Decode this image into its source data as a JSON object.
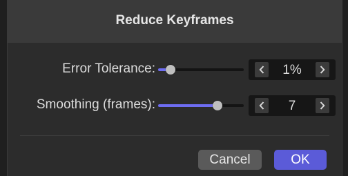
{
  "dialog": {
    "title": "Reduce Keyframes"
  },
  "fields": [
    {
      "label": "Error Tolerance:",
      "slider_value_fraction": 0.1,
      "value": "1%"
    },
    {
      "label": "Smoothing (frames):",
      "slider_value_fraction": 0.72,
      "value": "7"
    }
  ],
  "buttons": {
    "cancel_label": "Cancel",
    "ok_label": "OK"
  },
  "colors": {
    "accent": "#6e6df2",
    "ok_button": "#5b5bd8",
    "cancel_button": "#5a5a5a",
    "background": "#2c2c2c",
    "titlebar": "#3a3a3a"
  },
  "icons": {
    "decrement": "chevron-left-icon",
    "increment": "chevron-right-icon"
  }
}
